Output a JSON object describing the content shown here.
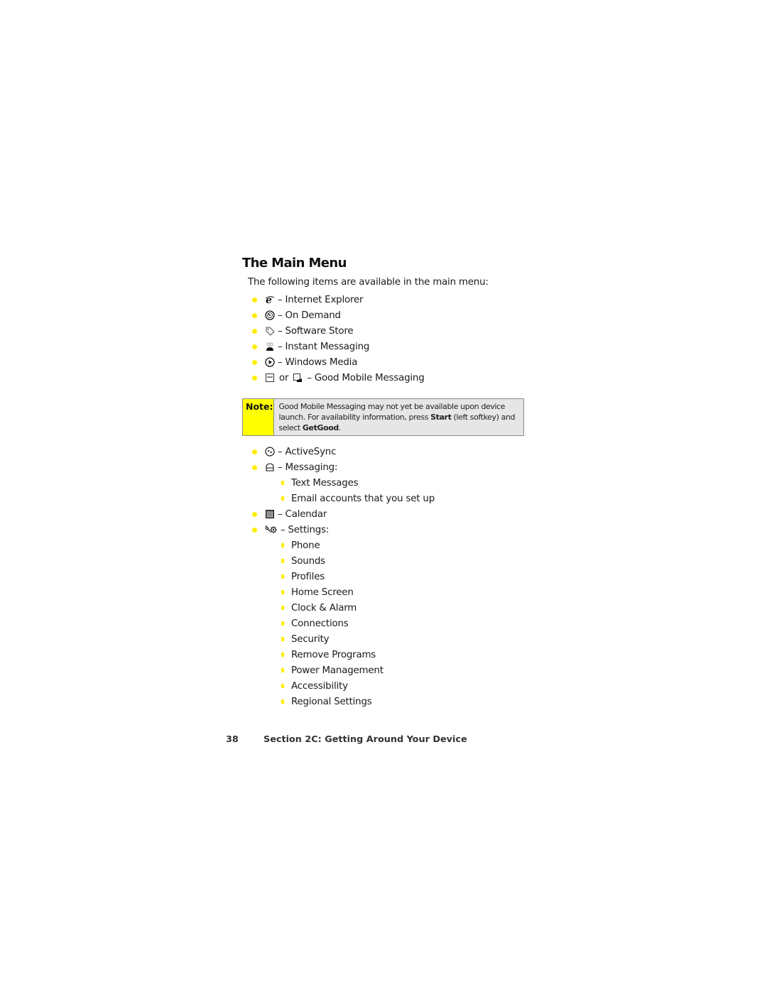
{
  "page": {
    "title": "The Main Menu",
    "intro": "The following items are available in the main menu:"
  },
  "menu_items_top": [
    {
      "icon": "internet-explorer-icon",
      "label": "– Internet Explorer"
    },
    {
      "icon": "on-demand-icon",
      "label": "– On Demand"
    },
    {
      "icon": "software-store-icon",
      "label": "– Software Store"
    },
    {
      "icon": "instant-messaging-icon",
      "label": "– Instant Messaging"
    },
    {
      "icon": "windows-media-icon",
      "label": "– Windows Media"
    },
    {
      "icon": "good-mobile-messaging-icon",
      "connector": "or",
      "label": "– Good Mobile Messaging"
    }
  ],
  "note": {
    "label": "Note:",
    "text_1": "Good Mobile Messaging may not yet be available upon device launch. For availability information, press ",
    "bold_1": "Start",
    "text_2": " (left softkey) and select ",
    "bold_2": "GetGood",
    "text_3": "."
  },
  "menu_items_bottom": [
    {
      "icon": "activesync-icon",
      "label": "– ActiveSync"
    },
    {
      "icon": "messaging-icon",
      "label": "– Messaging:",
      "sub": [
        "Text Messages",
        "Email accounts that you set up"
      ]
    },
    {
      "icon": "calendar-icon",
      "label": "– Calendar"
    },
    {
      "icon": "settings-icon",
      "label": "– Settings:",
      "sub": [
        "Phone",
        "Sounds",
        "Profiles",
        "Home Screen",
        "Clock & Alarm",
        "Connections",
        "Security",
        "Remove Programs",
        "Power Management",
        "Accessibility",
        "Regional Settings"
      ]
    }
  ],
  "footer": {
    "page_number": "38",
    "section": "Section 2C: Getting Around Your Device"
  },
  "colors": {
    "bullet": "#ffee00",
    "note_label_bg": "#ffff00",
    "note_body_bg": "#e6e6e6"
  }
}
